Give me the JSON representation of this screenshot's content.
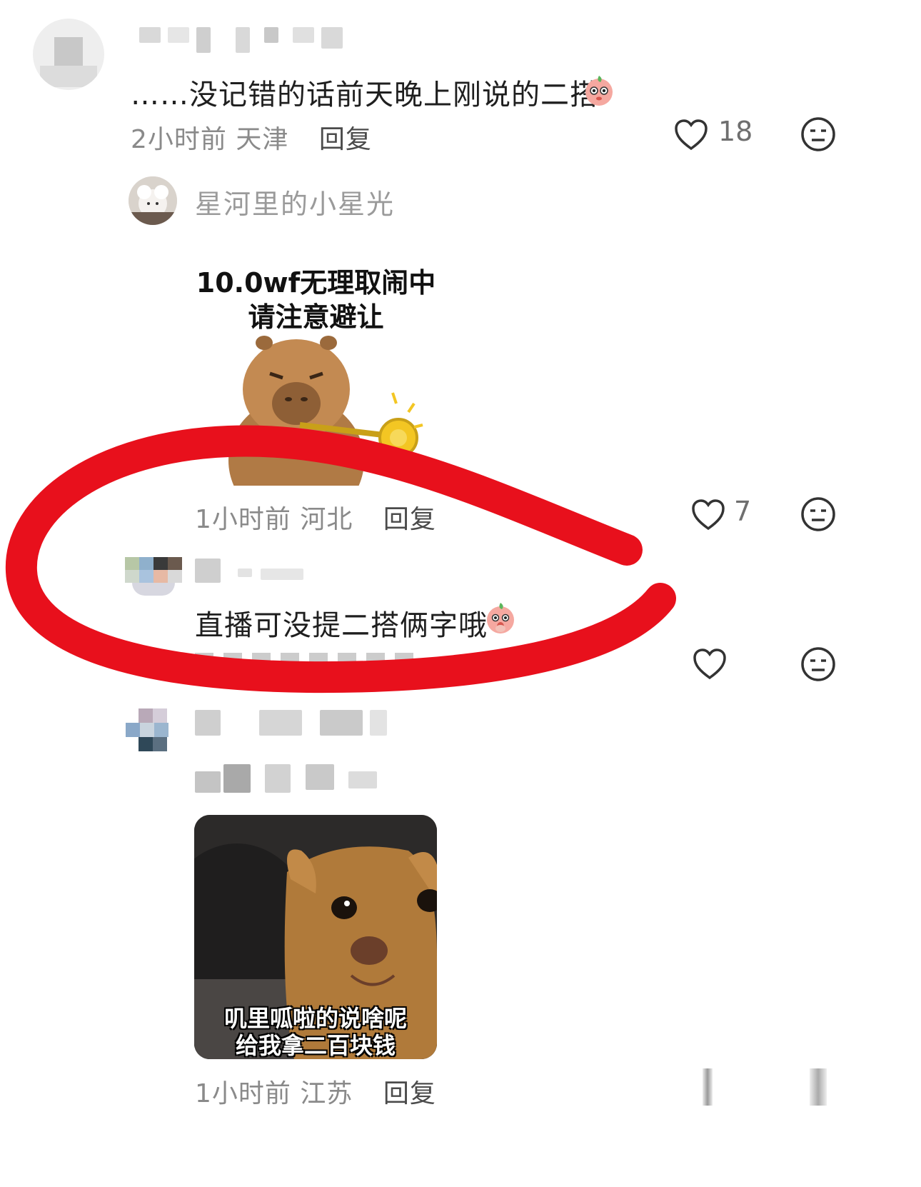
{
  "comments": [
    {
      "text": "……没记错的话前天晚上刚说的二搭",
      "time": "2小时前",
      "location": "天津",
      "reply_label": "回复",
      "like_count": "18",
      "emoji_icon": "blushing-face-emoji"
    },
    {
      "username": "星河里的小星光",
      "sticker": {
        "line1": "10.0wf无理取闹中",
        "line2": "请注意避让"
      },
      "time": "1小时前",
      "location": "河北",
      "reply_label": "回复",
      "like_count": "7"
    },
    {
      "text": "直播可没提二搭俩字哦",
      "emoji_icon": "shy-face-emoji"
    },
    {
      "meme": {
        "line1": "叽里呱啦的说啥呢",
        "line2": "给我拿二百块钱"
      },
      "time": "1小时前",
      "location": "江苏",
      "reply_label": "回复"
    }
  ],
  "colors": {
    "annotation": "#e8101c",
    "meta_text": "#8a8a8a"
  }
}
